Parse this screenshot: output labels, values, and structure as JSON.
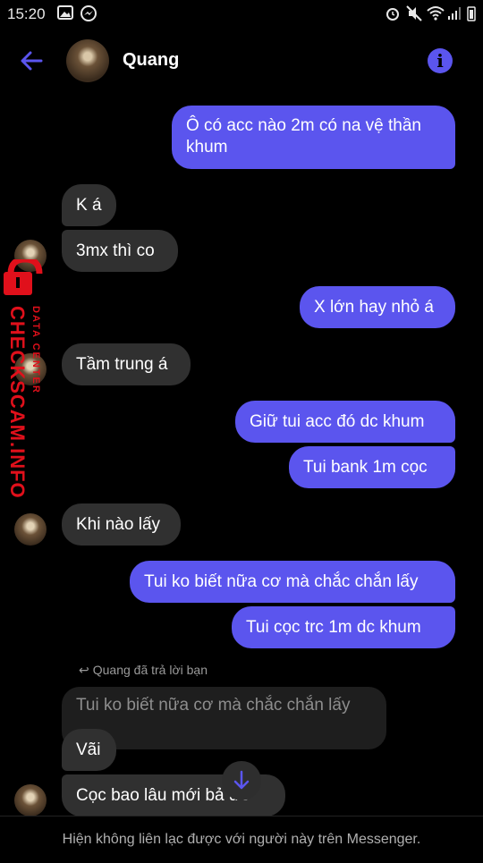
{
  "status": {
    "time": "15:20",
    "icons_left": [
      "image-icon",
      "messenger-icon"
    ],
    "icons_right": [
      "alarm-icon",
      "mute-icon",
      "wifi-icon",
      "signal-icon",
      "battery-icon"
    ]
  },
  "header": {
    "contact_name": "Quang",
    "back_icon": "arrow-left-icon",
    "info_icon": "info-icon",
    "accent": "#5b55ee"
  },
  "messages": [
    {
      "side": "out",
      "lines": [
        "Ô có acc nào 2m có na vệ thần",
        "khum"
      ]
    },
    {
      "side": "in",
      "text": "K á"
    },
    {
      "side": "in",
      "text": "3mx thì co"
    },
    {
      "side": "out",
      "text": "X lớn hay nhỏ á"
    },
    {
      "side": "in",
      "text": "Tầm trung á"
    },
    {
      "side": "out",
      "text": "Giữ tui acc đó dc khum"
    },
    {
      "side": "out",
      "text": "Tui bank 1m cọc"
    },
    {
      "side": "in",
      "text": "Khi nào lấy"
    },
    {
      "side": "out",
      "text": "Tui ko biết nữa cơ mà chắc chắn lấy"
    },
    {
      "side": "out",
      "text": "Tui cọc trc 1m dc khum"
    },
    {
      "side": "in",
      "text": "Vãi"
    },
    {
      "side": "in",
      "text": "Cọc bao lâu mới bả ức"
    }
  ],
  "reply": {
    "note": "Quang đã trả lời bạn",
    "quoted": "Tui ko biết nữa cơ mà chắc chắn lấy"
  },
  "watermark": {
    "main": "CHECKSCAM.INFO",
    "sub": "DATA CENTER"
  },
  "footer": {
    "text": "Hiện không liên lạc được với người này trên Messenger."
  }
}
